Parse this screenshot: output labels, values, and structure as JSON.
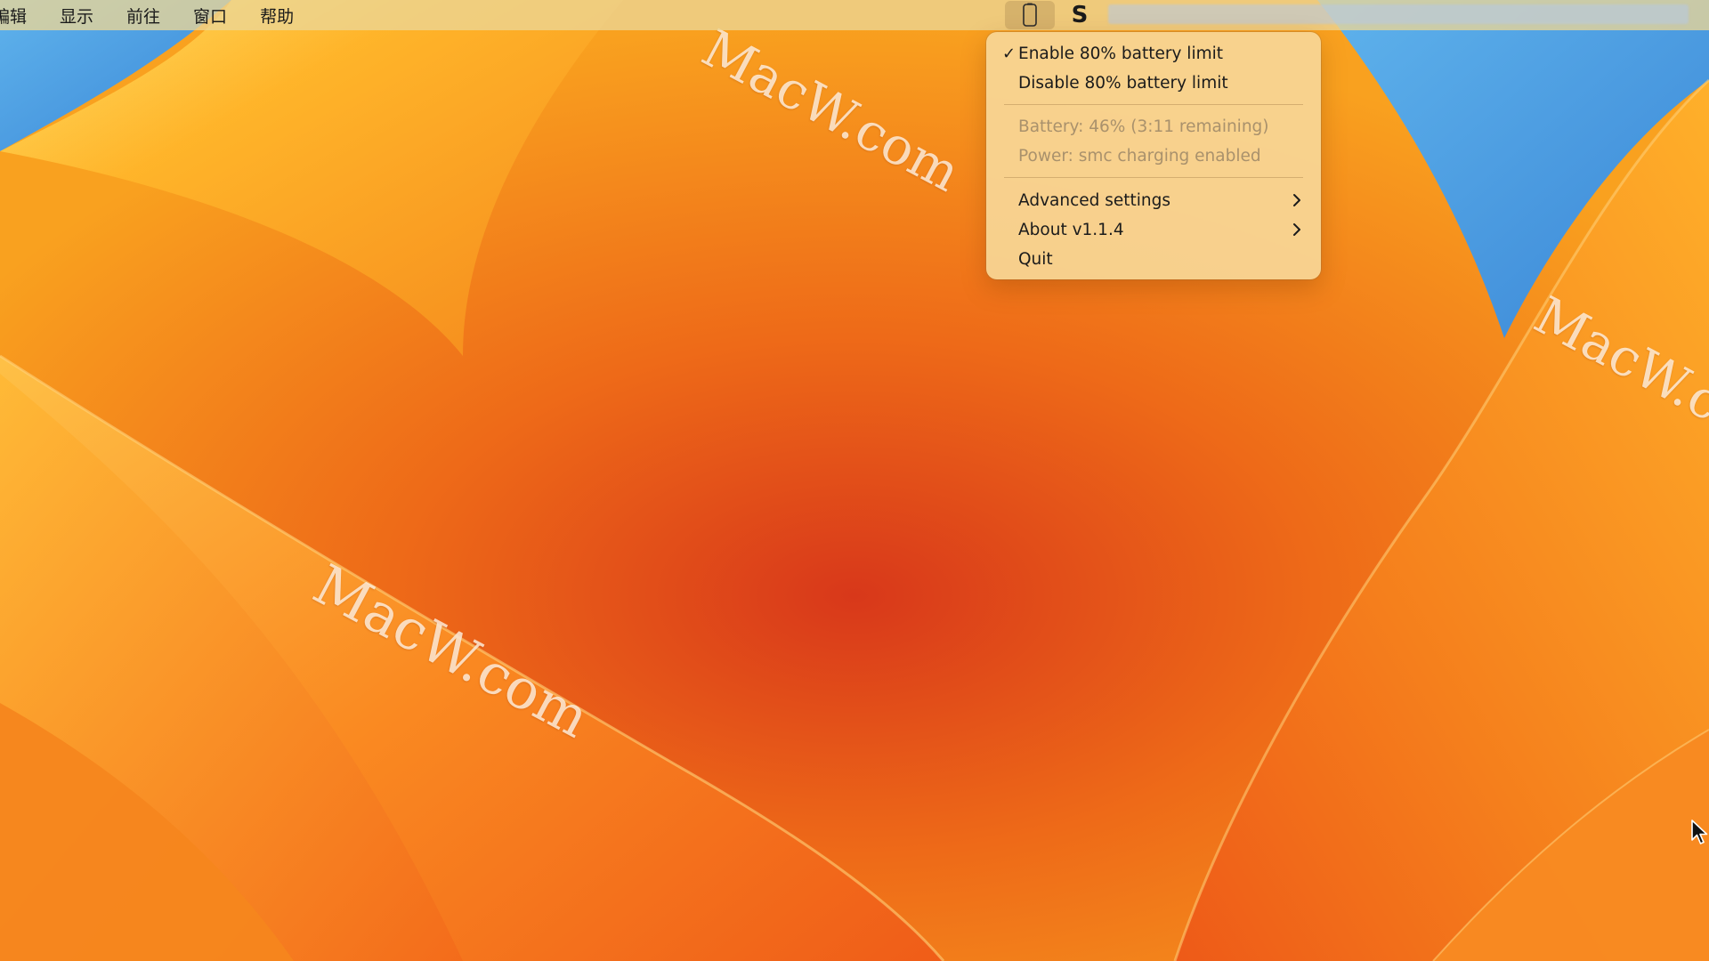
{
  "menubar": {
    "items": [
      "编辑",
      "显示",
      "前往",
      "窗口",
      "帮助"
    ]
  },
  "status_icons": {
    "battery_icon": "battery-icon",
    "s_icon_label": "S"
  },
  "dropdown": {
    "items": [
      {
        "label": "Enable 80% battery limit",
        "checked": true,
        "enabled": true,
        "submenu": false
      },
      {
        "label": "Disable 80% battery limit",
        "checked": false,
        "enabled": true,
        "submenu": false
      },
      {
        "label": "Battery: 46% (3:11 remaining)",
        "checked": false,
        "enabled": false,
        "submenu": false
      },
      {
        "label": "Power: smc charging enabled",
        "checked": false,
        "enabled": false,
        "submenu": false
      },
      {
        "label": "Advanced settings",
        "checked": false,
        "enabled": true,
        "submenu": true
      },
      {
        "label": "About v1.1.4",
        "checked": false,
        "enabled": true,
        "submenu": true
      },
      {
        "label": "Quit",
        "checked": false,
        "enabled": true,
        "submenu": false
      }
    ],
    "check_glyph": "✓"
  },
  "watermarks": [
    "MacW.com",
    "MacW.com",
    "MacW.com"
  ],
  "colors": {
    "wallpaper_orange": "#f28a1c",
    "wallpaper_red": "#d8401a",
    "wallpaper_yellow": "#ffd04a",
    "sky_blue": "#4a98de",
    "menu_bg": "#f8d696",
    "menu_disabled_text": "#a9916c"
  }
}
